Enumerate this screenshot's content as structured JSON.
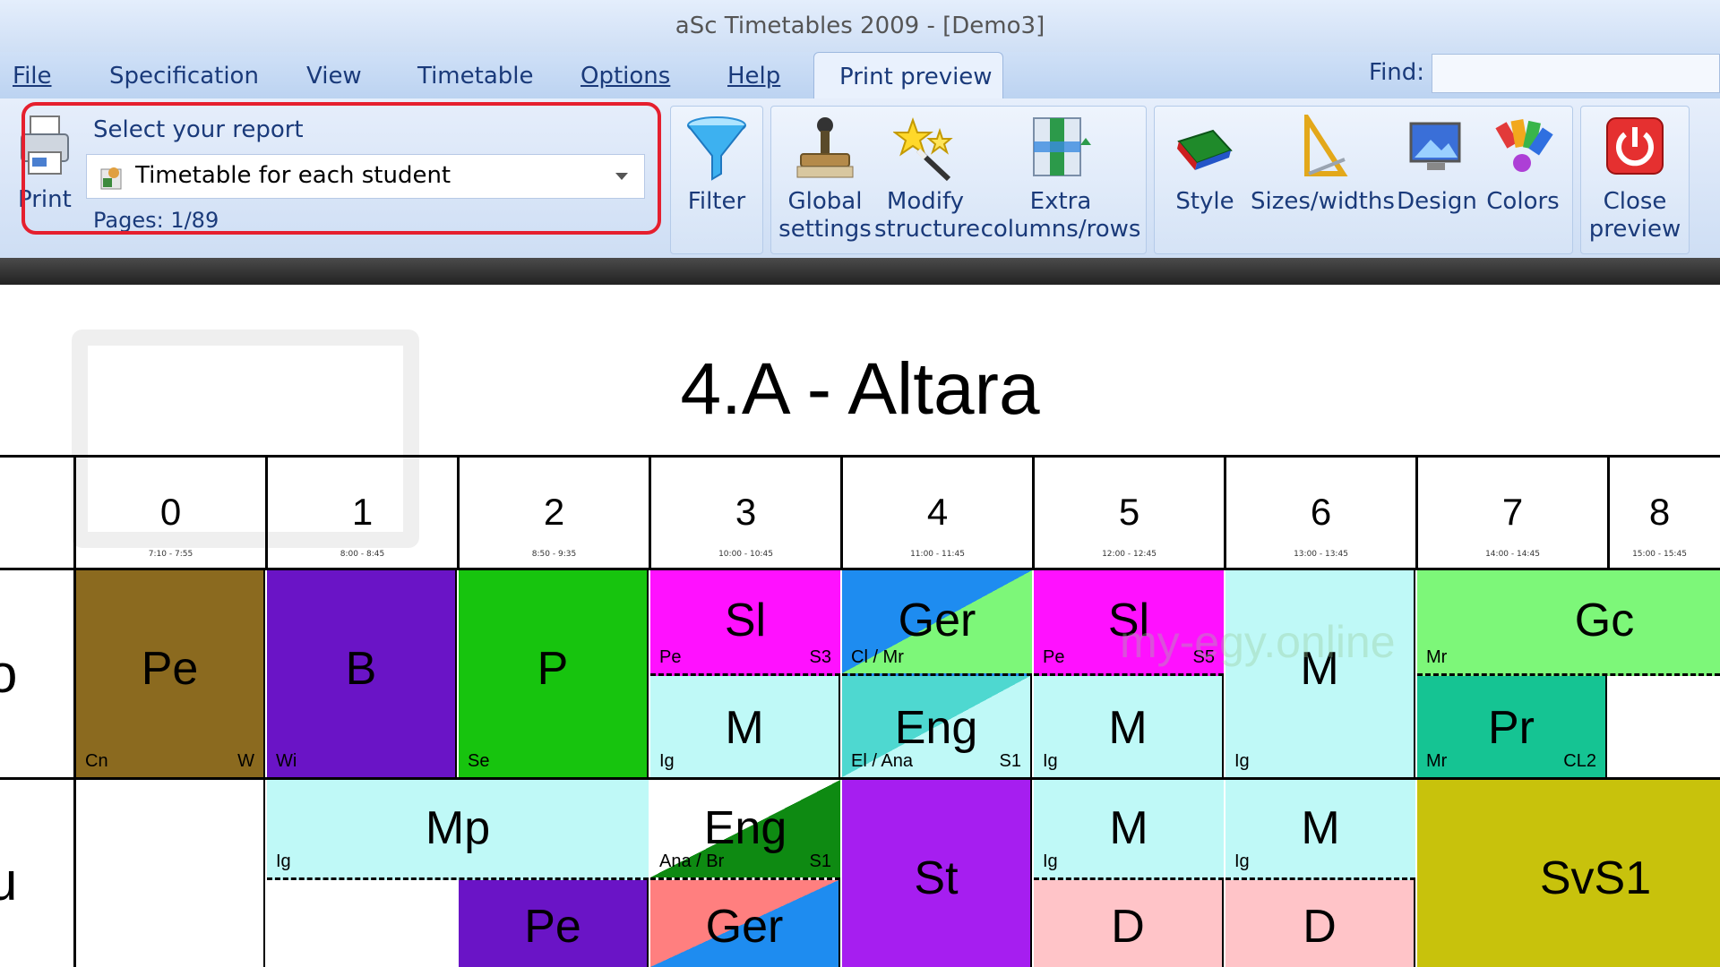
{
  "window": {
    "title": "aSc Timetables 2009  - [Demo3]"
  },
  "menu": {
    "items": [
      {
        "id": "file",
        "label": "File"
      },
      {
        "id": "specification",
        "label": "Specification"
      },
      {
        "id": "view",
        "label": "View"
      },
      {
        "id": "timetable",
        "label": "Timetable"
      },
      {
        "id": "options",
        "label": "Options"
      },
      {
        "id": "help",
        "label": "Help"
      }
    ],
    "active_tab": "Print preview",
    "find_label": "Find:"
  },
  "ribbon": {
    "print": "Print",
    "report_label": "Select your report",
    "report_value": "Timetable for each student",
    "pages": "Pages: 1/89",
    "filter": "Filter",
    "global_settings": [
      "Global",
      "settings"
    ],
    "modify_structure": [
      "Modify",
      "structure"
    ],
    "extra_columns": [
      "Extra",
      "columns/rows"
    ],
    "style": "Style",
    "sizes": "Sizes/widths",
    "design": "Design",
    "colors": "Colors",
    "close_preview": [
      "Close",
      "preview"
    ]
  },
  "colors": {
    "highlight": "#e51f2e",
    "brown": "#8b6a1f",
    "purple": "#6a14c6",
    "green": "#17c40e",
    "magenta": "#ff11ff",
    "lightcyan": "#bff9f7",
    "teal": "#15c493",
    "lightgreen": "#7df779",
    "olive": "#c8c20c",
    "violet": "#a61ef0",
    "pink": "#ffc4c8"
  },
  "preview": {
    "class_title": "4.A - Altara",
    "watermark": "my-egy.online",
    "periods": [
      {
        "num": "0",
        "time": "7:10 - 7:55"
      },
      {
        "num": "1",
        "time": "8:00 - 8:45"
      },
      {
        "num": "2",
        "time": "8:50 - 9:35"
      },
      {
        "num": "3",
        "time": "10:00 - 10:45"
      },
      {
        "num": "4",
        "time": "11:00 - 11:45"
      },
      {
        "num": "5",
        "time": "12:00 - 12:45"
      },
      {
        "num": "6",
        "time": "13:00 - 13:45"
      },
      {
        "num": "7",
        "time": "14:00 - 14:45"
      },
      {
        "num": "8",
        "time": "15:00 - 15:45"
      }
    ],
    "row_labels": [
      "o",
      "u"
    ],
    "cells": {
      "pe": {
        "subj": "Pe",
        "tl": "Cn",
        "tr": "W"
      },
      "b": {
        "subj": "B",
        "tl": "Wi"
      },
      "p": {
        "subj": "P",
        "tl": "Se"
      },
      "sl3": {
        "subj": "Sl",
        "tl": "Pe",
        "tr": "S3"
      },
      "m3": {
        "subj": "M",
        "tl": "Ig"
      },
      "ger4": {
        "subj": "Ger",
        "tl": "Cl / Mr"
      },
      "eng4": {
        "subj": "Eng",
        "tl": "El / Ana",
        "tr": "S1"
      },
      "sl5": {
        "subj": "Sl",
        "tl": "Pe",
        "tr": "S5"
      },
      "m5": {
        "subj": "M",
        "tl": "Ig"
      },
      "m6": {
        "subj": "M",
        "tl": "Ig"
      },
      "gc": {
        "subj": "Gc",
        "tl": "Mr"
      },
      "pr": {
        "subj": "Pr",
        "tl": "Mr",
        "tr": "CL2"
      },
      "mp": {
        "subj": "Mp",
        "tl": "Ig"
      },
      "pe2": {
        "subj": "Pe"
      },
      "eng3": {
        "subj": "Eng",
        "tl": "Ana / Br",
        "tr": "S1"
      },
      "ger3": {
        "subj": "Ger"
      },
      "st": {
        "subj": "St"
      },
      "m5b": {
        "subj": "M",
        "tl": "Ig"
      },
      "d5": {
        "subj": "D"
      },
      "m6b": {
        "subj": "M",
        "tl": "Ig"
      },
      "d6": {
        "subj": "D"
      },
      "svs": {
        "subj": "SvS1"
      }
    }
  }
}
